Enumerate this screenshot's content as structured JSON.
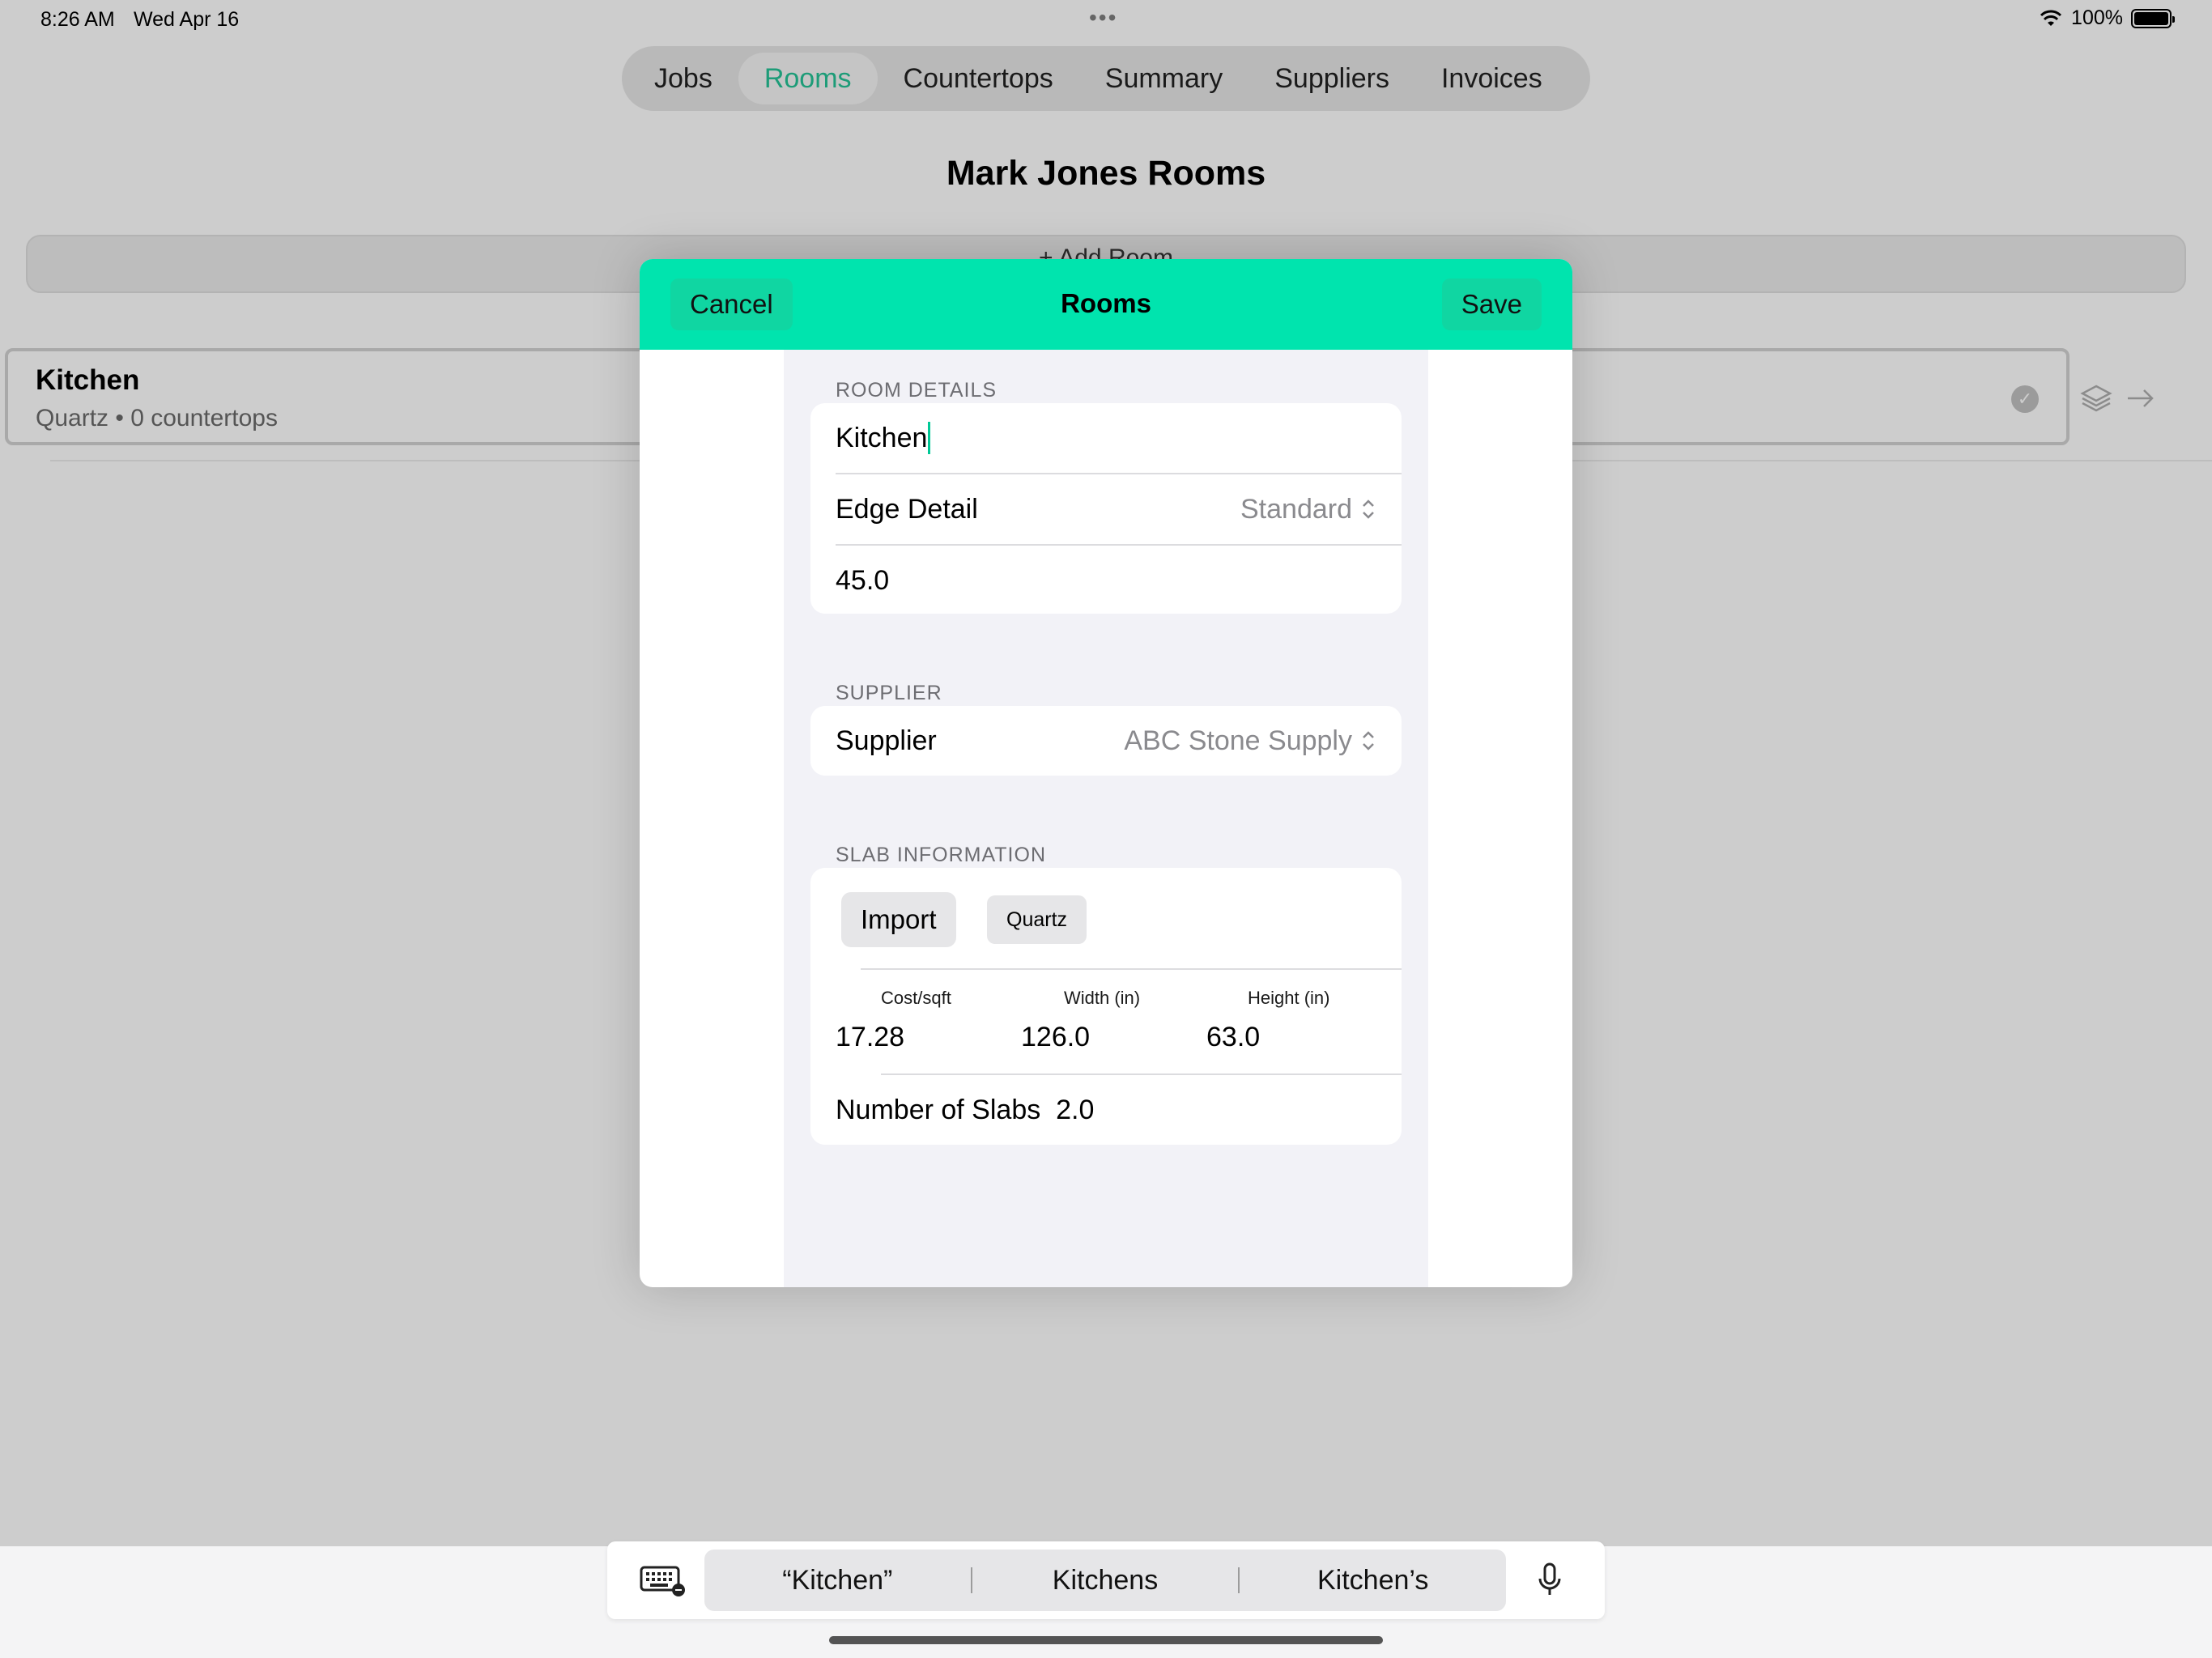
{
  "status_bar": {
    "time": "8:26 AM",
    "date": "Wed Apr 16",
    "battery": "100%"
  },
  "tabs": [
    {
      "label": "Jobs",
      "active": false
    },
    {
      "label": "Rooms",
      "active": true
    },
    {
      "label": "Countertops",
      "active": false
    },
    {
      "label": "Summary",
      "active": false
    },
    {
      "label": "Suppliers",
      "active": false
    },
    {
      "label": "Invoices",
      "active": false
    }
  ],
  "page": {
    "title": "Mark Jones Rooms",
    "add_label": "+ Add Room"
  },
  "room": {
    "name": "Kitchen",
    "subtitle": "Quartz • 0 countertops"
  },
  "modal": {
    "cancel": "Cancel",
    "title": "Rooms",
    "save": "Save",
    "room_details": {
      "section": "ROOM DETAILS",
      "name_value": "Kitchen",
      "edge_label": "Edge Detail",
      "edge_value": "Standard",
      "measure_value": "45.0"
    },
    "supplier": {
      "section": "SUPPLIER",
      "label": "Supplier",
      "value": "ABC Stone Supply"
    },
    "slab": {
      "section": "SLAB INFORMATION",
      "import": "Import",
      "material": "Quartz",
      "cost_head": "Cost/sqft",
      "width_head": "Width (in)",
      "height_head": "Height (in)",
      "cost": "17.28",
      "width": "126.0",
      "height": "63.0",
      "slabs_label": "Number of Slabs",
      "slabs_value": "2.0"
    }
  },
  "keyboard": {
    "suggestions": [
      "“Kitchen”",
      "Kitchens",
      "Kitchen’s"
    ]
  },
  "colors": {
    "accent": "#00e4ae",
    "active_tab": "#1d9c78"
  }
}
